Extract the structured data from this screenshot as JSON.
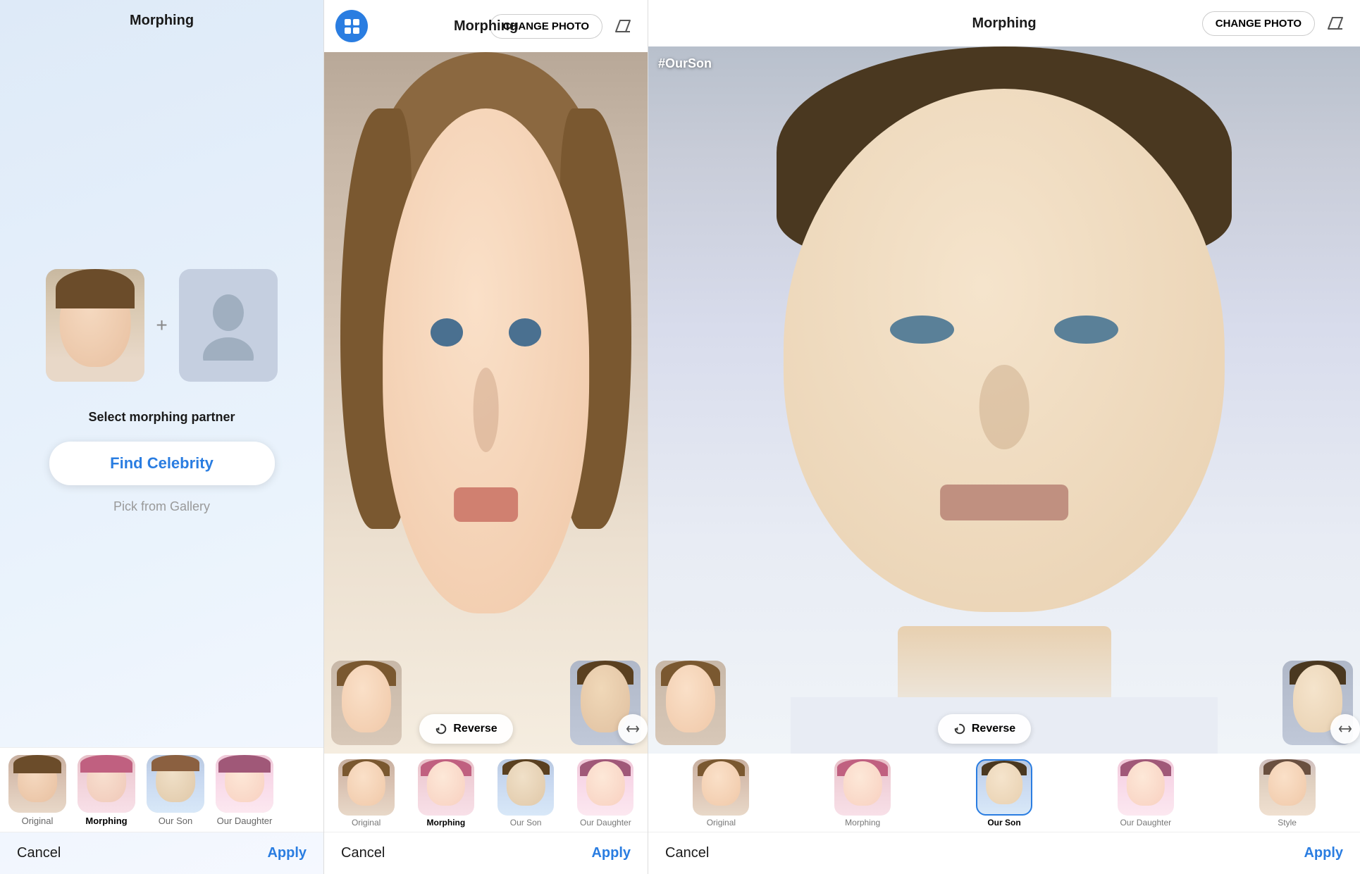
{
  "panels": [
    {
      "id": "panel1",
      "title": "Morphing",
      "select_label": "Select morphing partner",
      "find_celebrity_btn": "Find Celebrity",
      "pick_gallery": "Pick from Gallery",
      "cancel": "Cancel",
      "apply": "Apply",
      "tabs": [
        {
          "label": "Original",
          "style": "original",
          "active": false
        },
        {
          "label": "Morphing",
          "style": "morphing",
          "active": true
        },
        {
          "label": "Our Son",
          "style": "our-son",
          "active": false
        },
        {
          "label": "Our Daughter",
          "style": "our-daughter",
          "active": false
        }
      ]
    },
    {
      "id": "panel2",
      "title": "Morphing",
      "change_photo_btn": "CHANGE PHOTO",
      "reverse_btn": "Reverse",
      "cancel": "Cancel",
      "apply": "Apply",
      "hashtag": "",
      "tabs": [
        {
          "label": "Original",
          "style": "original",
          "active": false
        },
        {
          "label": "Morphing",
          "style": "morphing",
          "active": true
        },
        {
          "label": "Our Son",
          "style": "our-son",
          "active": false
        },
        {
          "label": "Our Daughter",
          "style": "our-daughter",
          "active": false
        }
      ]
    },
    {
      "id": "panel3",
      "title": "Morphing",
      "change_photo_btn": "CHANGE PHOTO",
      "reverse_btn": "Reverse",
      "cancel": "Cancel",
      "apply": "Apply",
      "hashtag": "#OurSon",
      "tabs": [
        {
          "label": "Original",
          "style": "original",
          "active": false
        },
        {
          "label": "Morphing",
          "style": "morphing",
          "active": false
        },
        {
          "label": "Our Son",
          "style": "our-son",
          "active": true
        },
        {
          "label": "Our Daughter",
          "style": "our-daughter",
          "active": false
        },
        {
          "label": "Style",
          "style": "style",
          "active": false
        }
      ]
    }
  ],
  "icons": {
    "grid": "⊞",
    "eraser": "◇",
    "reverse": "↻",
    "expand": "↔"
  }
}
